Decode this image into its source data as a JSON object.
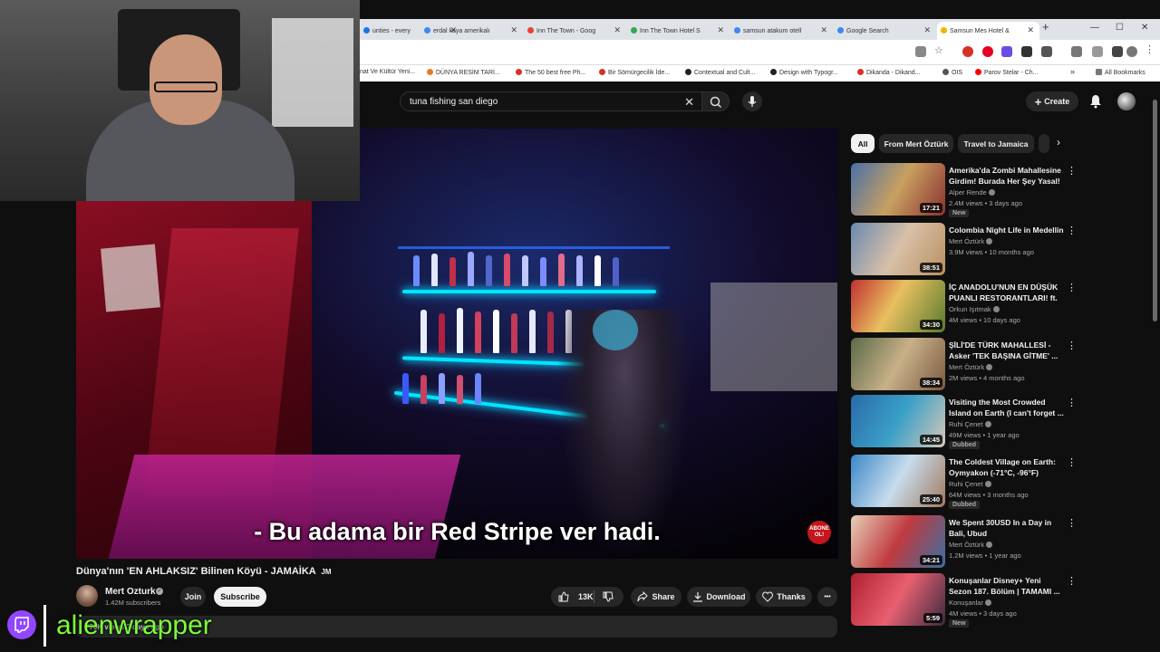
{
  "browser": {
    "tabs": [
      {
        "label": "unties - every",
        "color": "#1a73e8"
      },
      {
        "label": "erdal kaya amerikalı",
        "color": "#4285f4"
      },
      {
        "label": "Inn The Town - Goog",
        "color": "#ea4335"
      },
      {
        "label": "Inn The Town Hotel S",
        "color": "#34a853"
      },
      {
        "label": "samsun atakum otell",
        "color": "#4285f4"
      },
      {
        "label": "Google Search",
        "color": "#4285f4"
      },
      {
        "label": "Samsun Mes Hotel &",
        "color": "#f4b400"
      }
    ],
    "new_tab": "+",
    "window_controls": [
      "—",
      "☐",
      "✕"
    ],
    "bookmarks": [
      {
        "label": "nat Ve Kültür Yeni...",
        "color": "#999"
      },
      {
        "label": "DÜNYA RESİM TARİ...",
        "color": "#e67c22"
      },
      {
        "label": "The 50 best free Ph...",
        "color": "#d93025"
      },
      {
        "label": "Bir Sömürgecilik İde...",
        "color": "#d93025"
      },
      {
        "label": "Contextual and Cult...",
        "color": "#222"
      },
      {
        "label": "Design with Typogr...",
        "color": "#222"
      },
      {
        "label": "Dikanda - Dikand...",
        "color": "#d93025"
      },
      {
        "label": "OIS",
        "color": "#555"
      },
      {
        "label": "Parov Stelar - Ch...",
        "color": "#ff0000"
      }
    ],
    "more_bookmarks": "»",
    "all_bookmarks": "All Bookmarks"
  },
  "youtube": {
    "search_query": "tuna fishing san diego",
    "create_label": "Create",
    "video": {
      "subtitle": "- Bu adama bir Red Stripe ver hadi.",
      "abone_text": "ABONE OL!",
      "title": "Dünya'nın 'EN AHLAKSIZ' Bilinen Köyü - JAMAİKA",
      "title_suffix": "JM",
      "channel": "Mert Ozturk",
      "subscribers": "1.42M subscribers",
      "join_label": "Join",
      "subscribe_label": "Subscribe",
      "likes": "13K",
      "share_label": "Share",
      "download_label": "Download",
      "thanks_label": "Thanks",
      "more_label": "•••",
      "views_summary": "770K views  3 days ago"
    },
    "chips": [
      "All",
      "From Mert Öztürk",
      "Travel to Jamaica"
    ],
    "recommendations": [
      {
        "title": "Amerika'da Zombi Mahallesine Girdim! Burada Her Şey Yasal! ...",
        "channel": "Alper Rende",
        "meta": "2.4M views • 3 days ago",
        "badge": "New",
        "duration": "17:21"
      },
      {
        "title": "Colombia Night Life in Medellin",
        "channel": "Mert Öztürk",
        "meta": "3.9M views • 10 months ago",
        "badge": "",
        "duration": "38:51"
      },
      {
        "title": "İÇ ANADOLU'NUN EN DÜŞÜK PUANLI RESTORANTLARI! ft. ...",
        "channel": "Orkun Işıtmak",
        "meta": "4M views • 10 days ago",
        "badge": "",
        "duration": "34:30"
      },
      {
        "title": "ŞİLİ'DE TÜRK MAHALLESİ - Asker 'TEK BAŞINA GİTME' ...",
        "channel": "Mert Öztürk",
        "meta": "2M views • 4 months ago",
        "badge": "",
        "duration": "38:34"
      },
      {
        "title": "Visiting the Most Crowded Island on Earth (I can't forget ...",
        "channel": "Ruhi Çenet",
        "meta": "49M views • 1 year ago",
        "badge": "Dubbed",
        "duration": "14:45"
      },
      {
        "title": "The Coldest Village on Earth: Oymyakon (-71°C, -96°F)",
        "channel": "Ruhi Çenet",
        "meta": "64M views • 3 months ago",
        "badge": "Dubbed",
        "duration": "25:40"
      },
      {
        "title": "We Spent 30USD In a Day in Bali, Ubud",
        "channel": "Mert Öztürk",
        "meta": "1.2M views • 1 year ago",
        "badge": "",
        "duration": "34:21"
      },
      {
        "title": "Konuşanlar Disney+ Yeni Sezon 187. Bölüm | TAMAMI ...",
        "channel": "Konuşanlar",
        "meta": "4M views • 3 days ago",
        "badge": "New",
        "duration": "5:59"
      }
    ]
  },
  "stream": {
    "username": "alienwrapper"
  },
  "colors": {
    "twitch_purple": "#9146ff",
    "username_green": "#7cff3a",
    "youtube_bg": "#0f0f0f"
  }
}
